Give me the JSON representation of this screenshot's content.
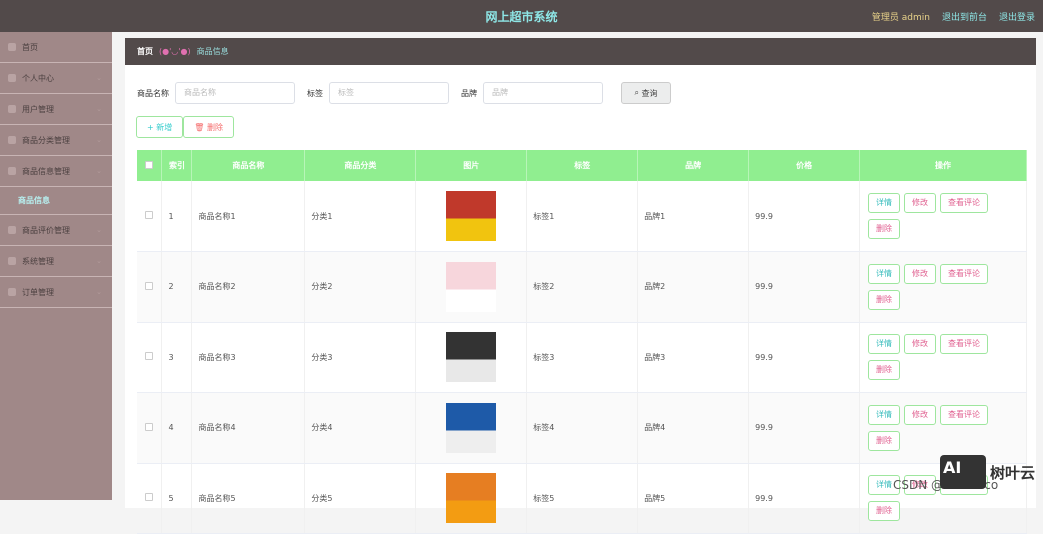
{
  "header": {
    "title": "网上超市系统",
    "admin": "管理员 admin",
    "to_front": "退出到前台",
    "logout": "退出登录"
  },
  "sidebar": {
    "items": [
      "首页",
      "个人中心",
      "用户管理",
      "商品分类管理",
      "商品信息管理"
    ],
    "active_sub": "商品信息",
    "items_after": [
      "商品评价管理",
      "系统管理",
      "订单管理"
    ]
  },
  "breadcrumb": {
    "home": "首页",
    "sep": "(●'◡'●)",
    "current": "商品信息"
  },
  "search": {
    "name_label": "商品名称",
    "name_placeholder": "商品名称",
    "tag_label": "标签",
    "tag_placeholder": "标签",
    "brand_label": "品牌",
    "brand_placeholder": "品牌",
    "query": "查询"
  },
  "actions": {
    "add": "+ 新增",
    "delete": "删除"
  },
  "table": {
    "headers": [
      "",
      "索引",
      "商品名称",
      "商品分类",
      "图片",
      "标签",
      "品牌",
      "价格",
      "操作"
    ],
    "rows": [
      {
        "idx": "1",
        "name": "商品名称1",
        "cat": "分类1",
        "tag": "标签1",
        "brand": "品牌1",
        "price": "99.9"
      },
      {
        "idx": "2",
        "name": "商品名称2",
        "cat": "分类2",
        "tag": "标签2",
        "brand": "品牌2",
        "price": "99.9"
      },
      {
        "idx": "3",
        "name": "商品名称3",
        "cat": "分类3",
        "tag": "标签3",
        "brand": "品牌3",
        "price": "99.9"
      },
      {
        "idx": "4",
        "name": "商品名称4",
        "cat": "分类4",
        "tag": "标签4",
        "brand": "品牌4",
        "price": "99.9"
      },
      {
        "idx": "5",
        "name": "商品名称5",
        "cat": "分类5",
        "tag": "标签5",
        "brand": "品牌5",
        "price": "99.9"
      }
    ],
    "ops": {
      "detail": "详情",
      "edit": "修改",
      "review": "查看评论",
      "delete": "删除"
    }
  },
  "watermark": {
    "csdn": "CSDN @...er-coco",
    "logo": "AI",
    "brand": "树叶云"
  }
}
